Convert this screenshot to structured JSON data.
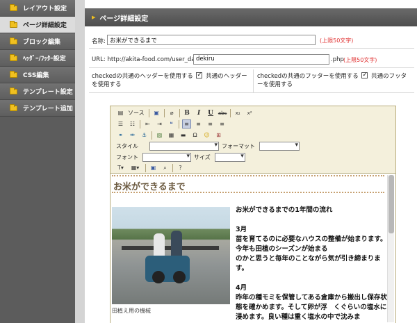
{
  "sidebar": {
    "items": [
      {
        "label": "レイアウト設定",
        "active": false
      },
      {
        "label": "ページ詳細設定",
        "active": true
      },
      {
        "label": "ブロック編集",
        "active": false
      },
      {
        "label": "ﾍｯﾀﾞｰ/ﾌｯﾀｰ設定",
        "active": false
      },
      {
        "label": "CSS編集",
        "active": false
      },
      {
        "label": "テンプレート設定",
        "active": false
      },
      {
        "label": "テンプレート追加",
        "active": false
      }
    ]
  },
  "header": {
    "title": "ページ詳細設定"
  },
  "form": {
    "name_label": "名称:",
    "name_value": "お米ができるまで",
    "name_limit": "(上限50文字)",
    "url_label": "URL: http://akita-food.com/user_data/",
    "url_value": "dekiru",
    "url_suffix": ".php",
    "url_limit": "(上限50文字)",
    "header_check_label": "checkedの共通のヘッダーを使用する",
    "header_check_text": "共通のヘッダーを使用する",
    "footer_check_label": "checkedの共通のフッターを使用する",
    "footer_check_text": "共通のフッターを使用する"
  },
  "toolbar": {
    "source": "ソース",
    "style_label": "スタイル",
    "format_label": "フォーマット",
    "font_label": "フォント",
    "size_label": "サイズ"
  },
  "document": {
    "title": "お米ができるまで",
    "caption": "田植え用の機械",
    "heading": "お米ができるまでの1年間の流れ",
    "month1": "3月",
    "para1": [
      "苗を育てるのに必要なハウスの整備が始まります。今年も田植のシーズンが始まる",
      "のかと思うと毎年のことながら気が引き締まります。"
    ],
    "month2": "4月",
    "para2": [
      "昨年の種モミを保管してある倉庫から搬出し保存状態を確かめます。そして卵が浮　くぐらいの塩水に浸めます。良い種は重く塩水の中で沈みま"
    ]
  }
}
